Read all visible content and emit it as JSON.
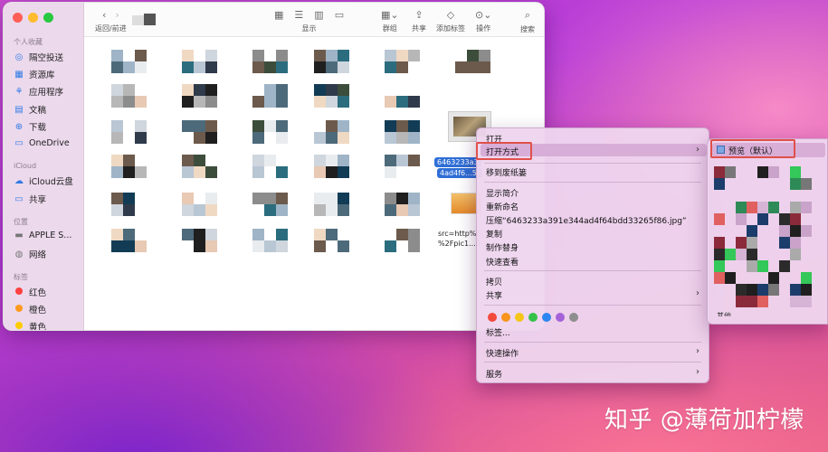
{
  "sidebar": {
    "favorites_title": "个人收藏",
    "favorites": [
      {
        "label": "隔空投送",
        "icon": "airdrop-icon"
      },
      {
        "label": "资源库",
        "icon": "library-icon"
      },
      {
        "label": "应用程序",
        "icon": "applications-icon"
      },
      {
        "label": "文稿",
        "icon": "document-icon"
      },
      {
        "label": "下载",
        "icon": "download-icon"
      },
      {
        "label": "OneDrive",
        "icon": "folder-icon"
      }
    ],
    "icloud_title": "iCloud",
    "icloud": [
      {
        "label": "iCloud云盘",
        "icon": "cloud-icon"
      },
      {
        "label": "共享",
        "icon": "shared-folder-icon"
      }
    ],
    "locations_title": "位置",
    "locations": [
      {
        "label": "APPLE S...",
        "icon": "disk-icon"
      },
      {
        "label": "网络",
        "icon": "globe-icon"
      }
    ],
    "tags_title": "标签",
    "tags": [
      {
        "label": "红色",
        "color": "#ff4040"
      },
      {
        "label": "橙色",
        "color": "#ff9a1f"
      },
      {
        "label": "黄色",
        "color": "#ffcc00"
      }
    ]
  },
  "toolbar": {
    "nav_label": "返回/前进",
    "view_label": "显示",
    "group_label": "群组",
    "share_label": "共享",
    "add_tag_label": "添加标签",
    "action_label": "操作",
    "search_label": "搜索"
  },
  "files": {
    "selected_label_line1": "6463233a3",
    "selected_label_line2": "4ad4f6...5f",
    "src_line1": "src=http%3",
    "src_line2": "%2Fpic1...0"
  },
  "context_menu": {
    "open": "打开",
    "open_with": "打开方式",
    "trash": "移到废纸篓",
    "get_info": "显示简介",
    "rename": "重新命名",
    "compress": "压缩“6463233a391e344ad4f64bdd33265f86.jpg”",
    "copy": "复制",
    "make_alias": "制作替身",
    "quick_look": "快速查看",
    "copy2": "拷贝",
    "share": "共享",
    "tag_colors": [
      "#f24a3d",
      "#f7951d",
      "#f5c518",
      "#35c24a",
      "#2d86f0",
      "#a562d8",
      "#8e8e8e"
    ],
    "tags": "标签...",
    "quick_actions": "快速操作",
    "services": "服务"
  },
  "submenu": {
    "preview": "预览（默认）",
    "other": "其他..."
  },
  "watermark": "知乎 @薄荷加柠檬"
}
